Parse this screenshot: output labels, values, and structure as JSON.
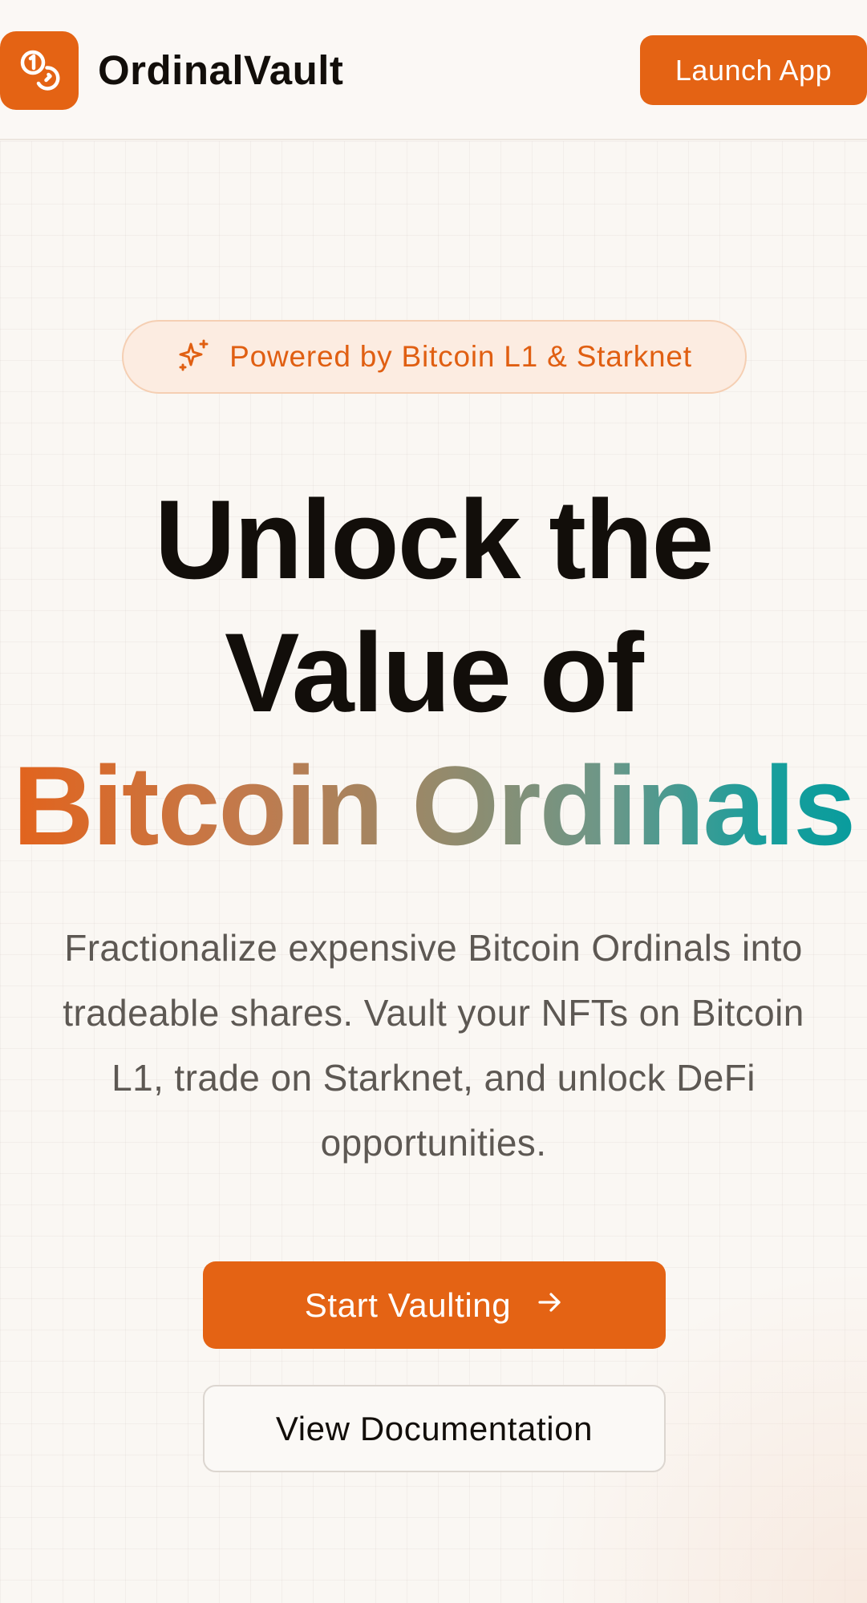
{
  "header": {
    "brand_name": "OrdinalVault",
    "logo_icon": "coins-icon",
    "launch_label": "Launch App"
  },
  "hero": {
    "badge": {
      "icon": "sparkles-icon",
      "text": "Powered by Bitcoin L1 & Starknet"
    },
    "headline_line1": "Unlock the",
    "headline_line2": "Value of",
    "headline_highlight": "Bitcoin Ordinals",
    "description": "Fractionalize expensive Bitcoin Ordinals into tradeable shares. Vault your NFTs on Bitcoin L1, trade on Starknet, and unlock DeFi opportunities.",
    "primary_cta": {
      "label": "Start Vaulting",
      "icon": "arrow-right-icon"
    },
    "secondary_cta": {
      "label": "View Documentation"
    }
  },
  "colors": {
    "accent": "#e46314",
    "gradient_start": "#e4621a",
    "gradient_end": "#079c9d",
    "background": "#faf7f3",
    "text_dark": "#120e0a",
    "text_muted": "#5d5853"
  }
}
